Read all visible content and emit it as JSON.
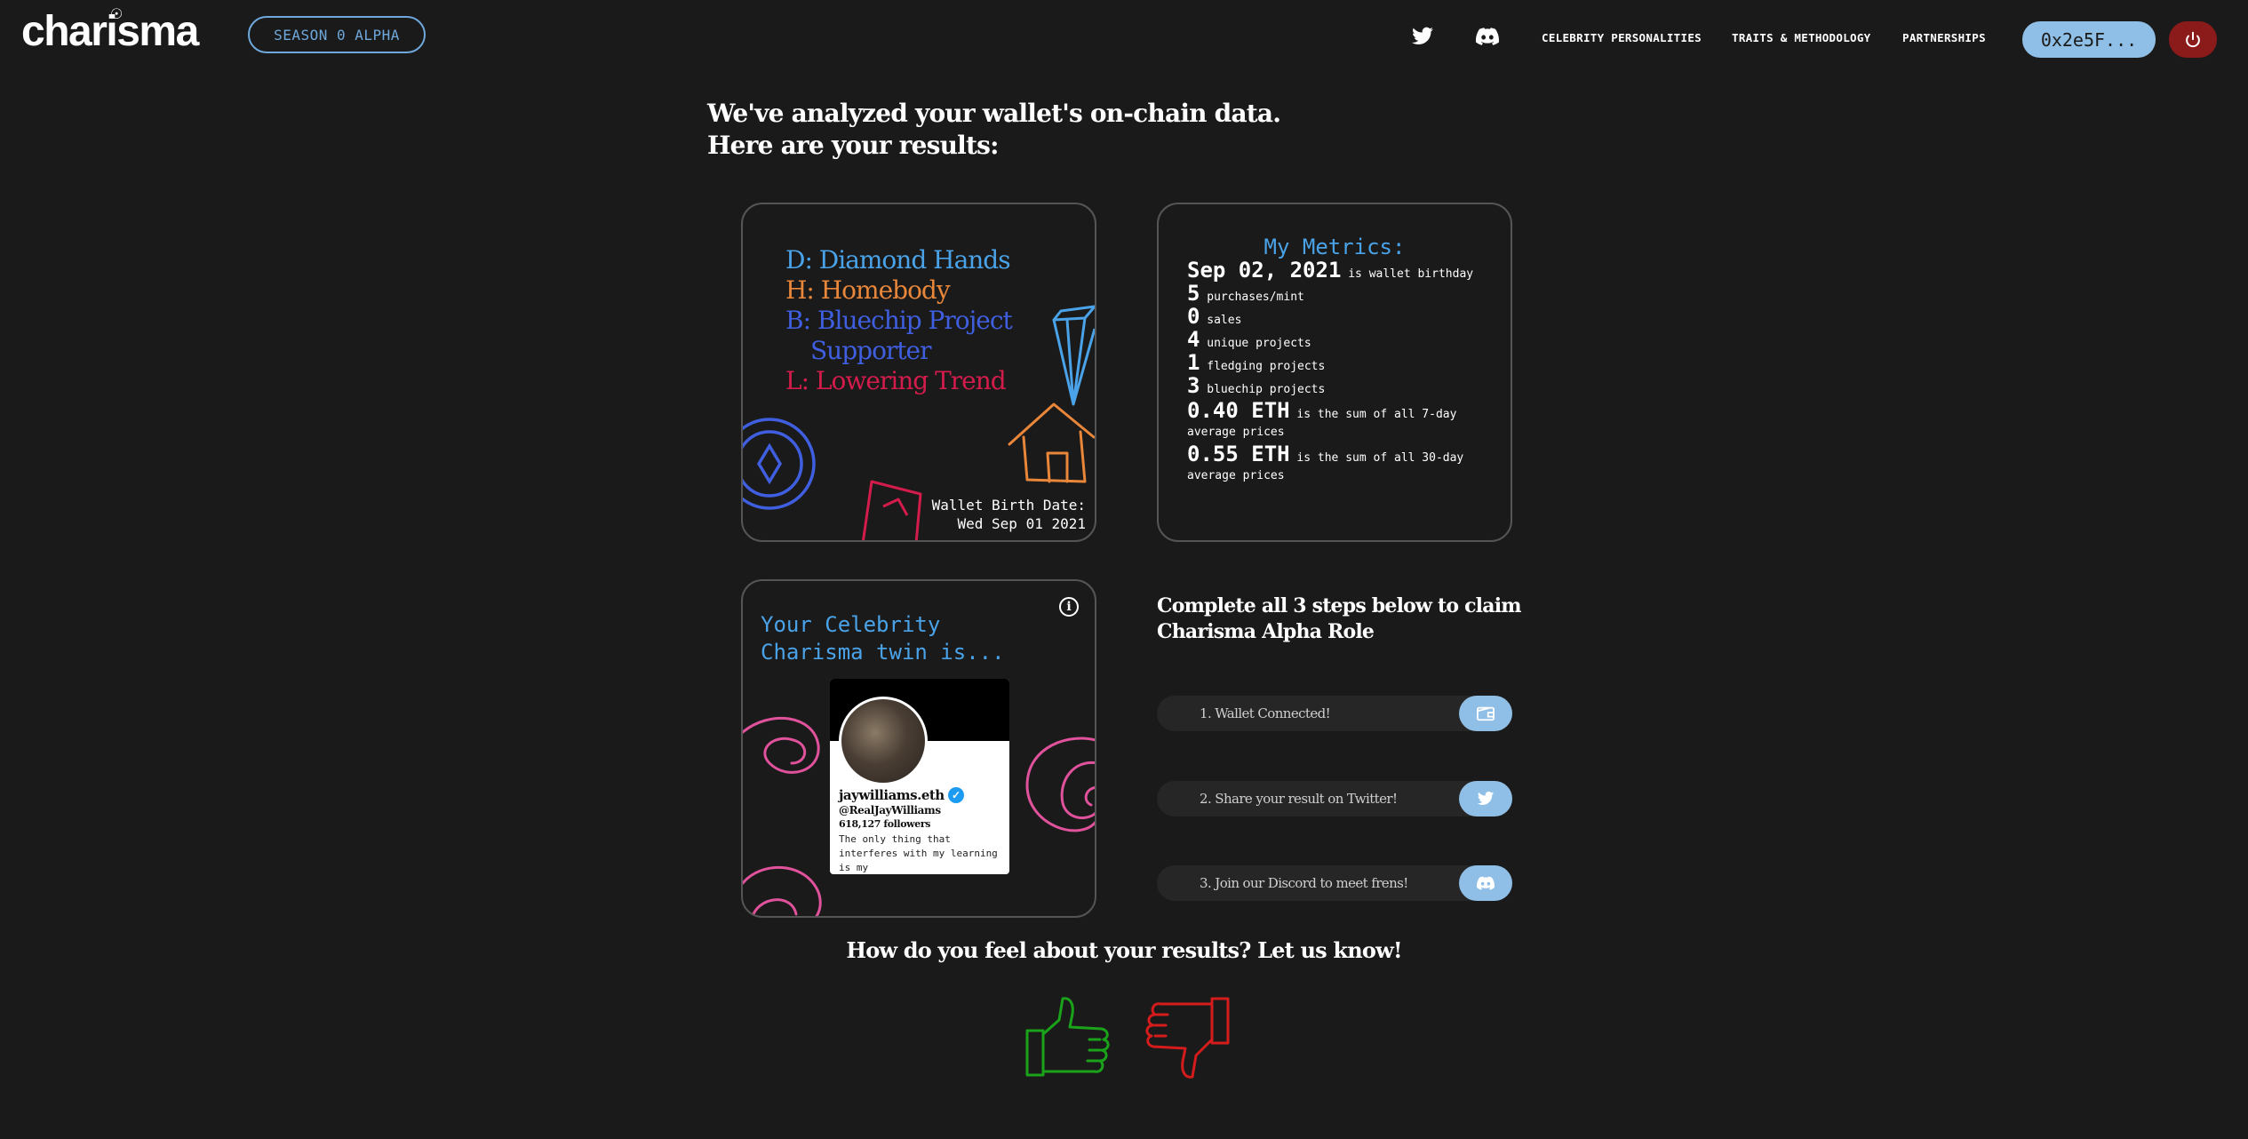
{
  "header": {
    "logo": "charisma",
    "season_label": "SEASON 0 ALPHA",
    "nav": {
      "celebrity": "CELEBRITY PERSONALITIES",
      "traits": "TRAITS & METHODOLOGY",
      "partnerships": "PARTNERSHIPS"
    },
    "wallet_label": "0x2e5F...",
    "icons": [
      "twitter-icon",
      "discord-icon",
      "power-icon"
    ]
  },
  "main": {
    "heading_line1": "We've analyzed your wallet's on-chain data.",
    "heading_line2": "Here are your results:"
  },
  "traits_card": {
    "traits": [
      {
        "code": "D",
        "text": "D: Diamond Hands",
        "color": "#4aa3e8"
      },
      {
        "code": "H",
        "text": "H: Homebody",
        "color": "#e8863a"
      },
      {
        "code": "B",
        "text": "B: Bluechip Project",
        "text2": "Supporter",
        "color": "#3f5fe0"
      },
      {
        "code": "L",
        "text": "L: Lowering Trend",
        "color": "#d41c4c"
      }
    ],
    "birth_label": "Wallet Birth Date:",
    "birth_value": "Wed Sep 01 2021"
  },
  "metrics": {
    "title": "My Metrics:",
    "rows": [
      {
        "value": "Sep 02, 2021",
        "label": "is wallet birthday"
      },
      {
        "value": "5",
        "label": "purchases/mint"
      },
      {
        "value": "0",
        "label": "sales"
      },
      {
        "value": "4",
        "label": "unique projects"
      },
      {
        "value": "1",
        "label": "fledging projects"
      },
      {
        "value": "3",
        "label": "bluechip projects"
      },
      {
        "value": "0.40 ETH",
        "label": "is the sum of all 7-day average prices"
      },
      {
        "value": "0.55 ETH",
        "label": "is the sum of all 30-day average prices"
      }
    ]
  },
  "twin": {
    "title": "Your Celebrity Charisma twin is...",
    "name": "jaywilliams.eth",
    "handle": "@RealJayWilliams",
    "followers": "618,127 followers",
    "bio": "The only thing that interferes with my learning is my"
  },
  "steps": {
    "heading": "Complete all 3 steps below to claim Charisma Alpha Role",
    "items": [
      {
        "label": "1. Wallet Connected!",
        "icon": "wallet-icon"
      },
      {
        "label": "2. Share your result on Twitter!",
        "icon": "twitter-icon"
      },
      {
        "label": "3. Join our Discord to meet frens!",
        "icon": "discord-icon"
      }
    ]
  },
  "feedback": {
    "question": "How do you feel about your results? Let us know!"
  },
  "colors": {
    "background": "#1a1a1a",
    "accent_blue": "#8fbfe6",
    "power_red": "#8b1a1a",
    "thumbs_up": "#1aa31a",
    "thumbs_down": "#d41c1c"
  }
}
